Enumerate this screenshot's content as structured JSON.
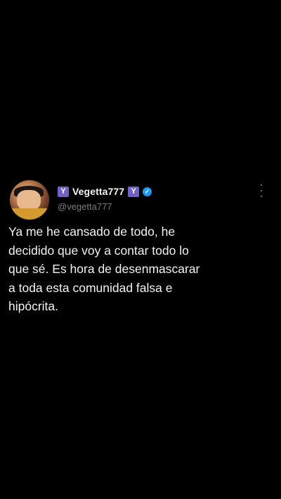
{
  "tweet": {
    "badge_left": "Y",
    "display_name": "Vegetta777",
    "badge_right": "Y",
    "verified_glyph": "✓",
    "handle": "@vegetta777",
    "text": "Ya me he cansado de todo, he\ndecidido que voy a contar todo lo\nque sé. Es hora de desenmascarar\na toda esta comunidad falsa e\nhipócrita.",
    "avatar_icon": "profile-avatar",
    "more_icon": "vertical-ellipsis-icon",
    "verified_icon": "verified-badge-icon"
  },
  "colors": {
    "background": "#000000",
    "text": "#f2f2f2",
    "handle": "#7a7a7a",
    "badge": "#6f63c9",
    "verified": "#1d9bf0"
  }
}
